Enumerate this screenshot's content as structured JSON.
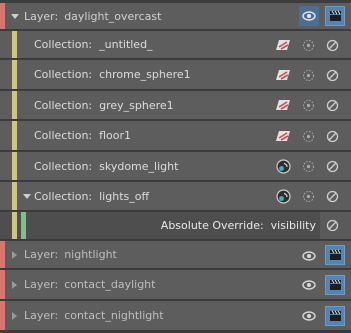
{
  "layers": [
    {
      "prefix": "Layer:",
      "name": "daylight_overcast",
      "expanded": true
    },
    {
      "prefix": "Layer:",
      "name": "nightlight",
      "expanded": false
    },
    {
      "prefix": "Layer:",
      "name": "contact_daylight",
      "expanded": false
    },
    {
      "prefix": "Layer:",
      "name": "contact_nightlight",
      "expanded": false
    }
  ],
  "collections": [
    {
      "prefix": "Collection:",
      "name": "_untitled_",
      "type_icon": "geometry-override-icon"
    },
    {
      "prefix": "Collection:",
      "name": "chrome_sphere1",
      "type_icon": "geometry-override-icon"
    },
    {
      "prefix": "Collection:",
      "name": "grey_sphere1",
      "type_icon": "geometry-override-icon"
    },
    {
      "prefix": "Collection:",
      "name": "floor1",
      "type_icon": "geometry-override-icon"
    },
    {
      "prefix": "Collection:",
      "name": "skydome_light",
      "type_icon": "light-icon"
    },
    {
      "prefix": "Collection:",
      "name": "lights_off",
      "type_icon": "light-icon",
      "expanded": true
    }
  ],
  "override": {
    "label": "Absolute Override:",
    "value": "visibility"
  },
  "colors": {
    "layer_strip": "#d77573",
    "collection_strip": "#c9c783",
    "override_strip": "#79c28b",
    "active_button": "#5285b4",
    "row_background": "#5d5d5d"
  }
}
